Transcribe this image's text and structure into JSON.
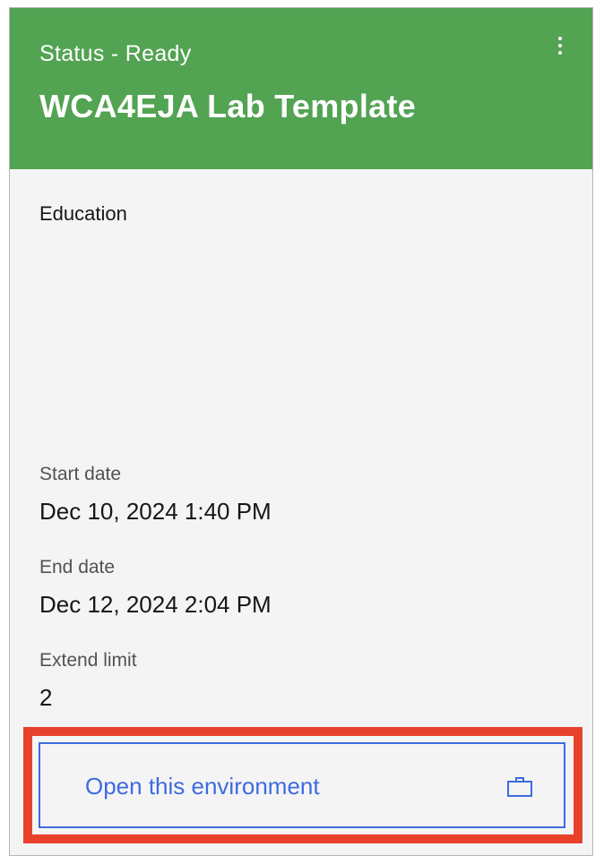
{
  "card": {
    "status": "Status - Ready",
    "title": "WCA4EJA Lab Template",
    "category": "Education",
    "fields": [
      {
        "label": "Start date",
        "value": "Dec 10, 2024 1:40 PM"
      },
      {
        "label": "End date",
        "value": "Dec 12, 2024 2:04 PM"
      },
      {
        "label": "Extend limit",
        "value": "2"
      }
    ],
    "action_label": "Open this environment",
    "overflow_icon": "overflow-menu-vertical-icon",
    "action_icon": "briefcase-icon"
  },
  "colors": {
    "header_bg": "#52a352",
    "card_bg": "#f4f4f4",
    "link_blue": "#3d6be0",
    "highlight_red": "#e8412b"
  }
}
